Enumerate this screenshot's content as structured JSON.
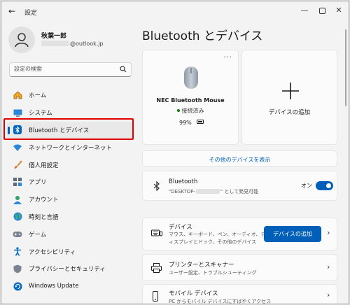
{
  "window": {
    "app_title": "設定",
    "back_glyph": "←",
    "minimize_glyph": "—",
    "close_glyph": "✕"
  },
  "profile": {
    "name": "秋葉一郎",
    "email_domain": "@outlook.jp"
  },
  "search": {
    "placeholder": "設定の検索"
  },
  "sidebar": {
    "items": [
      {
        "label": "ホーム",
        "icon": "home-icon"
      },
      {
        "label": "システム",
        "icon": "system-icon"
      },
      {
        "label": "Bluetooth とデバイス",
        "icon": "bluetooth-icon",
        "active": true
      },
      {
        "label": "ネットワークとインターネット",
        "icon": "network-icon"
      },
      {
        "label": "個人用設定",
        "icon": "brush-icon"
      },
      {
        "label": "アプリ",
        "icon": "apps-icon"
      },
      {
        "label": "アカウント",
        "icon": "account-icon"
      },
      {
        "label": "時刻と言語",
        "icon": "globe-icon"
      },
      {
        "label": "ゲーム",
        "icon": "gamepad-icon"
      },
      {
        "label": "アクセシビリティ",
        "icon": "accessibility-icon"
      },
      {
        "label": "プライバシーとセキュリティ",
        "icon": "shield-icon"
      },
      {
        "label": "Windows Update",
        "icon": "update-icon"
      }
    ]
  },
  "main": {
    "title": "Bluetooth とデバイス",
    "device_card": {
      "more": "...",
      "name": "NEC Bluetooth Mouse",
      "status": "接続済み",
      "battery": "99%"
    },
    "add_card": {
      "label": "デバイスの追加"
    },
    "show_more": "その他のデバイスを表示",
    "bluetooth": {
      "title": "Bluetooth",
      "sub_prefix": "\"DESKTOP-",
      "sub_suffix": "\" として発見可能",
      "state": "オン"
    },
    "rows": [
      {
        "title": "デバイス",
        "sub": "マウス、キーボード、ペン、オーディオ、ディスプレイとドック、その他のデバイス",
        "button": "デバイスの追加"
      },
      {
        "title": "プリンターとスキャナー",
        "sub": "ユーザー設定、トラブルシューティング"
      },
      {
        "title": "モバイル デバイス",
        "sub": "PC からモバイル デバイスにすばやくアクセス"
      }
    ],
    "chevron": "›"
  },
  "colors": {
    "accent": "#005fb8",
    "highlight_border": "#e00000",
    "window_bg": "#f3f3f3"
  }
}
